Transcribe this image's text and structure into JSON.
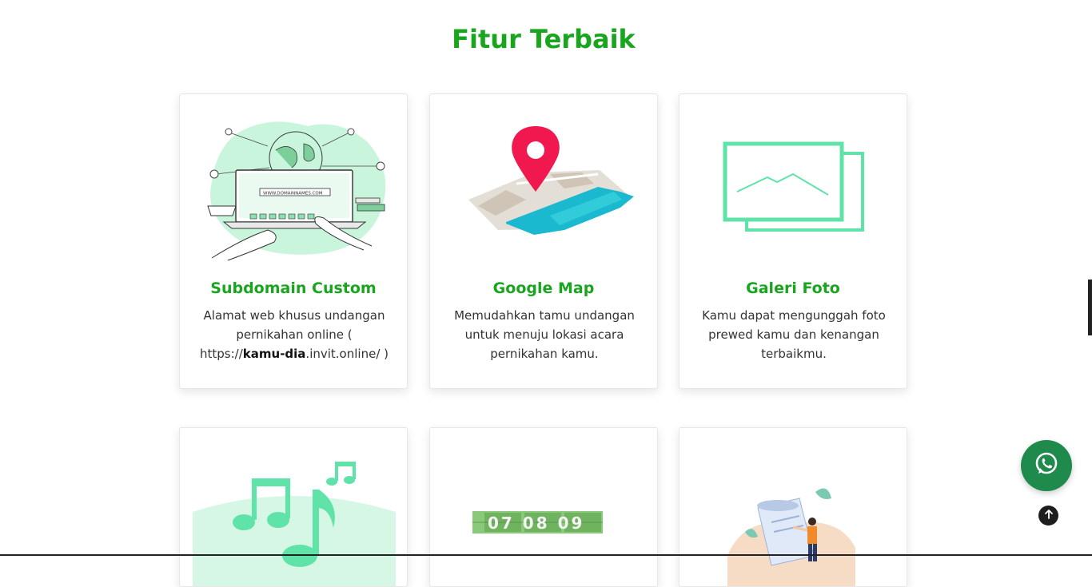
{
  "section": {
    "title": "Fitur Terbaik"
  },
  "features": [
    {
      "title": "Subdomain Custom",
      "desc_line1": "Alamat web khusus undangan pernikahan online ( https://",
      "desc_bold": "kamu-dia",
      "desc_line2": ".invit.online/ )",
      "art_text": "WWW.DOMAINNAMES.COM",
      "icon": "website-domain-illustration"
    },
    {
      "title": "Google Map",
      "desc": "Memudahkan tamu undangan untuk menuju lokasi acara pernikahan kamu.",
      "icon": "map-pin-illustration"
    },
    {
      "title": "Galeri Foto",
      "desc": "Kamu dapat mengunggah foto prewed kamu dan kenangan terbaikmu.",
      "icon": "photo-gallery-illustration"
    },
    {
      "icon": "music-notes-illustration"
    },
    {
      "icon": "countdown-illustration",
      "countdown": "07 08 09"
    },
    {
      "icon": "guestbook-illustration"
    }
  ],
  "colors": {
    "accent": "#1aa51f",
    "mint": "#5fe3a8",
    "whatsapp": "#1e8a4c",
    "pin": "#f0184e",
    "map_blue": "#1bb9cf"
  },
  "floating": {
    "whatsapp_icon": "whatsapp-icon",
    "top_icon": "arrow-up-icon"
  }
}
